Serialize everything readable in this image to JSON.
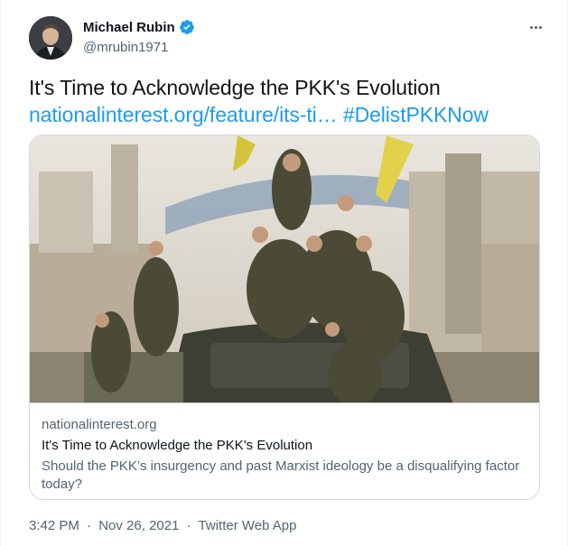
{
  "author": {
    "display_name": "Michael Rubin",
    "handle": "@mrubin1971",
    "verified_icon": "verified-badge-icon",
    "avatar_icon": "avatar-photo"
  },
  "tweet": {
    "text": "It's Time to Acknowledge the PKK's Evolution",
    "link": "nationalinterest.org/feature/its-ti…",
    "hashtag": "#DelistPKKNow"
  },
  "card": {
    "domain": "nationalinterest.org",
    "title": "It's Time to Acknowledge the PKK's Evolution",
    "description": "Should the PKK’s insurgency and past Marxist ideology be a disqualifying factor today?"
  },
  "meta": {
    "time": "3:42 PM",
    "sep1": "·",
    "date": "Nov 26, 2021",
    "sep2": "·",
    "source": "Twitter Web App"
  },
  "colors": {
    "link": "#1d9bf0",
    "secondary_text": "#536471",
    "border": "#cfd9de"
  }
}
